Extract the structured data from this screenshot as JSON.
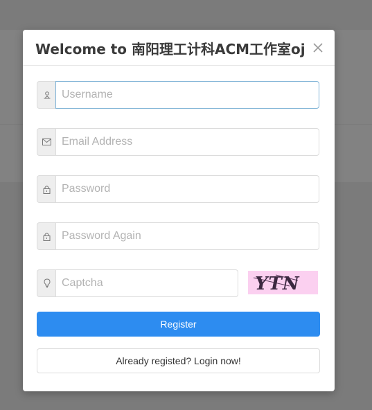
{
  "modal": {
    "title": "Welcome to 南阳理工计科ACM工作室oj",
    "close_icon": "close-icon"
  },
  "form": {
    "username": {
      "placeholder": "Username",
      "value": "",
      "icon": "user-icon"
    },
    "email": {
      "placeholder": "Email Address",
      "value": "",
      "icon": "envelope-icon"
    },
    "password": {
      "placeholder": "Password",
      "value": "",
      "icon": "lock-icon"
    },
    "password_again": {
      "placeholder": "Password Again",
      "value": "",
      "icon": "lock-icon"
    },
    "captcha": {
      "placeholder": "Captcha",
      "value": "",
      "icon": "lightbulb-icon",
      "image_text": "YTN"
    },
    "register_label": "Register",
    "login_label": "Already registed? Login now!"
  },
  "colors": {
    "primary": "#2d8cf0",
    "overlay": "#7b7b7b",
    "captcha_bg": "#fbd0f0"
  }
}
